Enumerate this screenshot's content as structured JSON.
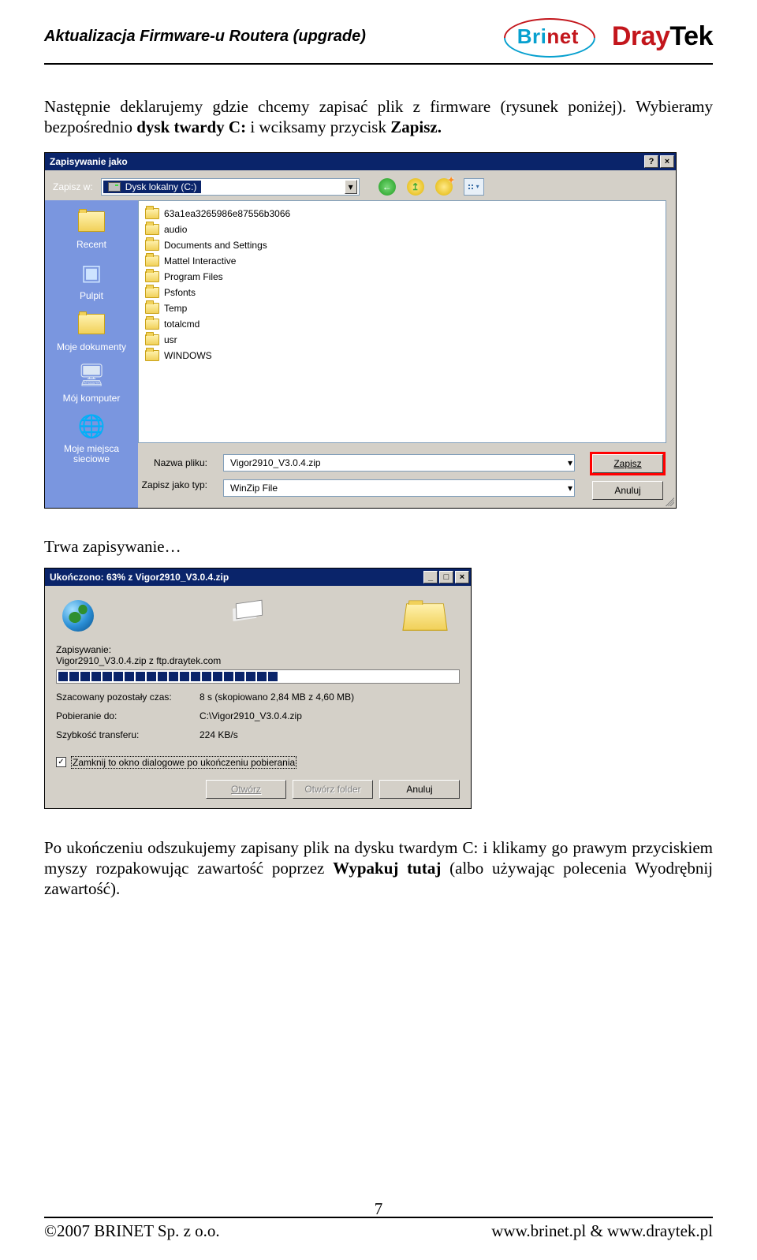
{
  "header": {
    "title": "Aktualizacja Firmware-u Routera (upgrade)",
    "brinet_bri": "Bri",
    "brinet_net": "net",
    "draytek_dray": "Dray",
    "draytek_tek": "Tek"
  },
  "para1_pre": "Następnie deklarujemy gdzie chcemy zapisać plik z firmware (rysunek poniżej). Wybieramy bezpośrednio ",
  "para1_b1": "dysk twardy C:",
  "para1_mid": "  i  wciksamy przycisk ",
  "para1_b2": "Zapisz.",
  "saveas": {
    "title": "Zapisywanie jako",
    "help_glyph": "?",
    "close_glyph": "×",
    "save_in_label": "Zapisz w:",
    "drive_label": "Dysk lokalny (C:)",
    "dd_glyph": "▾",
    "back_glyph": "←",
    "up_glyph": "↥",
    "places": [
      {
        "label": "Recent"
      },
      {
        "label": "Pulpit"
      },
      {
        "label": "Moje dokumenty"
      },
      {
        "label": "Mój komputer"
      },
      {
        "label": "Moje miejsca sieciowe"
      }
    ],
    "folders": [
      "63a1ea3265986e87556b3066",
      "audio",
      "Documents and Settings",
      "Mattel Interactive",
      "Program Files",
      "Psfonts",
      "Temp",
      "totalcmd",
      "usr",
      "WINDOWS"
    ],
    "filename_label": "Nazwa pliku:",
    "filename_value": "Vigor2910_V3.0.4.zip",
    "filetype_label": "Zapisz jako typ:",
    "filetype_value": "WinZip File",
    "btn_save": "Zapisz",
    "btn_cancel": "Anuluj"
  },
  "mid_text": "Trwa zapisywanie…",
  "download": {
    "title": "Ukończono: 63% z Vigor2910_V3.0.4.zip",
    "min_glyph": "_",
    "max_glyph": "□",
    "close_glyph": "×",
    "saving_label": "Zapisywanie:",
    "saving_value": "Vigor2910_V3.0.4.zip z ftp.draytek.com",
    "progress_filled": 20,
    "progress_total": 32,
    "rows": [
      {
        "k": "Szacowany pozostały czas:",
        "v": "8 s (skopiowano 2,84 MB z 4,60 MB)"
      },
      {
        "k": "Pobieranie do:",
        "v": "C:\\Vigor2910_V3.0.4.zip"
      },
      {
        "k": "Szybkość transferu:",
        "v": "224 KB/s"
      }
    ],
    "check_glyph": "✓",
    "checkbox_label": "Zamknij to okno dialogowe po ukończeniu pobierania",
    "btn_open": "Otwórz",
    "btn_open_folder": "Otwórz folder",
    "btn_cancel": "Anuluj"
  },
  "para2_pre": "Po ukończeniu odszukujemy zapisany plik na dysku twardym C:  i klikamy go prawym przyciskiem myszy rozpakowując zawartość poprzez ",
  "para2_b1": "Wypakuj tutaj",
  "para2_post": " (albo używając polecenia Wyodrębnij zawartość).",
  "footer": {
    "page": "7",
    "left": "©2007 BRINET Sp. z o.o.",
    "right": "www.brinet.pl  &  www.draytek.pl"
  }
}
